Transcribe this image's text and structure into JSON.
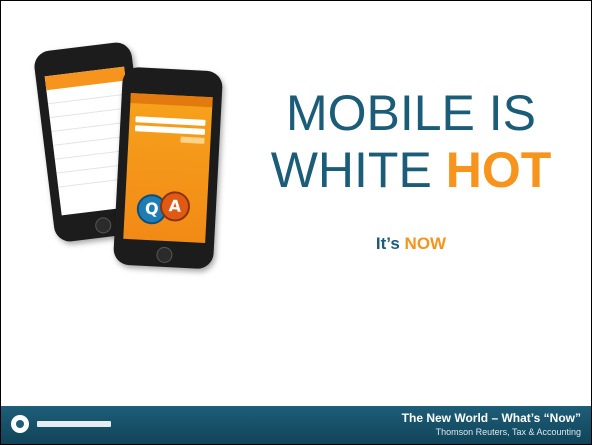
{
  "headline": {
    "line1": "MOBILE IS",
    "line2_prefix": "WHITE ",
    "line2_highlight": "HOT"
  },
  "subhead": {
    "prefix": "It’s ",
    "highlight": "NOW"
  },
  "phone_back": {
    "bar_label": "",
    "menu": [
      "",
      "",
      "",
      "",
      "",
      "",
      ""
    ]
  },
  "phone_front": {
    "bubble_q": "Q",
    "bubble_a": "A"
  },
  "footer": {
    "title": "The New World – What’s “Now”",
    "subtitle": "Thomson Reuters, Tax & Accounting"
  },
  "colors": {
    "headline_blue": "#1b5d78",
    "accent_orange": "#f7941d",
    "footer_blue": "#1e5e78"
  }
}
